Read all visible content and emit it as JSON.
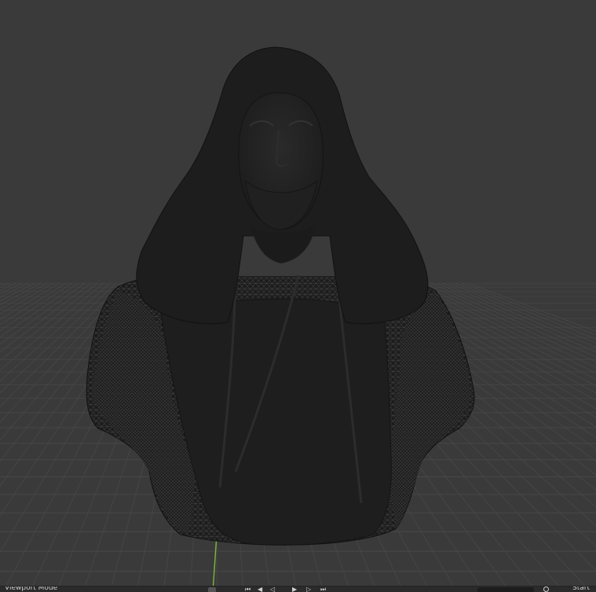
{
  "viewport": {
    "background": "#3a3a3a",
    "grid_color": "#4a4a4a",
    "y_axis_color": "#7fb83a",
    "model": "bust-mesh"
  },
  "bottom_bar": {
    "mode_label": "Viewport Mode",
    "right_label": "Start",
    "icons": [
      "keyframe-icon",
      "jump-start-icon",
      "step-back-icon",
      "play-reverse-icon",
      "play-icon",
      "step-forward-icon",
      "jump-end-icon"
    ]
  }
}
